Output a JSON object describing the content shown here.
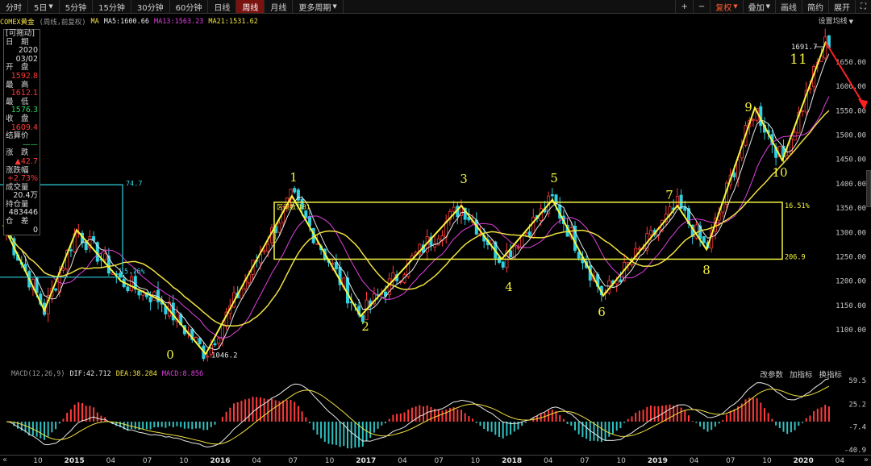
{
  "toolbar": {
    "left": [
      {
        "label": "分时",
        "active": false,
        "caret": false
      },
      {
        "label": "5日",
        "active": false,
        "caret": true
      },
      {
        "label": "5分钟",
        "active": false,
        "caret": false
      },
      {
        "label": "15分钟",
        "active": false,
        "caret": false
      },
      {
        "label": "30分钟",
        "active": false,
        "caret": false
      },
      {
        "label": "60分钟",
        "active": false,
        "caret": false
      },
      {
        "label": "日线",
        "active": false,
        "caret": false
      },
      {
        "label": "周线",
        "active": true,
        "caret": false
      },
      {
        "label": "月线",
        "active": false,
        "caret": false
      },
      {
        "label": "更多周期",
        "active": false,
        "caret": true
      }
    ],
    "right": {
      "plus": "+",
      "minus": "−",
      "fuquan": "复权",
      "diejia": "叠加",
      "huaxian": "画线",
      "jianyue": "简约",
      "zhankai": "展开",
      "expand_icon": "⛶"
    }
  },
  "infobar": {
    "symbol": "COMEX黄金",
    "mode": "(周线,前复权)",
    "ma_label": "MA",
    "ma5": "MA5:1600.66",
    "ma13": "MA13:1563.23",
    "ma21": "MA21:1531.62",
    "settings": "设置均线"
  },
  "leftpanel": {
    "header": "[可拖动]",
    "rows": [
      {
        "label": "日　期",
        "value": "2020",
        "color": "#e0e0e0"
      },
      {
        "label": "",
        "value": "03/02",
        "color": "#e0e0e0"
      },
      {
        "label": "开　盘",
        "value": "1592.8",
        "color": "#ff3b3b"
      },
      {
        "label": "最　高",
        "value": "1612.1",
        "color": "#ff3b3b"
      },
      {
        "label": "最　低",
        "value": "1576.3",
        "color": "#30d060"
      },
      {
        "label": "收　盘",
        "value": "1609.4",
        "color": "#ff3b3b"
      },
      {
        "label": "结算价",
        "value": "——",
        "color": "#30d060"
      },
      {
        "label": "涨　跌",
        "value": "▲42.7",
        "color": "#ff3b3b"
      },
      {
        "label": "涨跌幅",
        "value": "+2.73%",
        "color": "#ff3b3b"
      },
      {
        "label": "成交量",
        "value": "20.4万",
        "color": "#e0e0e0"
      },
      {
        "label": "持仓量",
        "value": "483446",
        "color": "#e0e0e0"
      },
      {
        "label": "仓　差",
        "value": "0",
        "color": "#e0e0e0"
      }
    ]
  },
  "annotations": {
    "peak_labels": [
      "0",
      "1",
      "2",
      "3",
      "4",
      "5",
      "6",
      "7",
      "8",
      "9",
      "10",
      "11"
    ],
    "high_price": "1691.7",
    "low_price": "1046.2",
    "cyan_top": "74.7",
    "cyan_mid": "5.76%",
    "rect_percent": "16.51%",
    "rect_height": "206.9",
    "rect_label": "区间数:181"
  },
  "yaxis_main": [
    "1650.00",
    "1600.00",
    "1550.00",
    "1500.00",
    "1450.00",
    "1400.00",
    "1350.00",
    "1300.00",
    "1250.00",
    "1200.00",
    "1150.00",
    "1100.00"
  ],
  "macd": {
    "name": "MACD(12,26,9)",
    "dif": "DIF:42.712",
    "dea": "DEA:38.284",
    "macd": "MACD:8.856",
    "buttons": [
      "改参数",
      "加指标",
      "换指标"
    ],
    "yaxis": [
      "59.5",
      "25.2",
      "-7.4",
      "-40.9"
    ]
  },
  "xaxis": {
    "ticks": [
      {
        "label": "10",
        "year": false
      },
      {
        "label": "2015",
        "year": true
      },
      {
        "label": "04",
        "year": false
      },
      {
        "label": "07",
        "year": false
      },
      {
        "label": "10",
        "year": false
      },
      {
        "label": "2016",
        "year": true
      },
      {
        "label": "04",
        "year": false
      },
      {
        "label": "07",
        "year": false
      },
      {
        "label": "10",
        "year": false
      },
      {
        "label": "2017",
        "year": true
      },
      {
        "label": "04",
        "year": false
      },
      {
        "label": "07",
        "year": false
      },
      {
        "label": "10",
        "year": false
      },
      {
        "label": "2018",
        "year": true
      },
      {
        "label": "04",
        "year": false
      },
      {
        "label": "07",
        "year": false
      },
      {
        "label": "10",
        "year": false
      },
      {
        "label": "2019",
        "year": true
      },
      {
        "label": "04",
        "year": false
      },
      {
        "label": "07",
        "year": false
      },
      {
        "label": "10",
        "year": false
      },
      {
        "label": "2020",
        "year": true
      },
      {
        "label": "04",
        "year": false
      }
    ],
    "left_arrow": "«",
    "right_arrow": "»"
  },
  "colors": {
    "up": "#ff3b3b",
    "down": "#30d0e0",
    "ma5": "#e8e8e8",
    "ma13": "#e040e0",
    "ma21": "#f0e040",
    "wave": "#f5f540",
    "cyan": "#30d0e0",
    "macd_up": "#ff3b3b",
    "macd_down": "#30c0c0"
  }
}
